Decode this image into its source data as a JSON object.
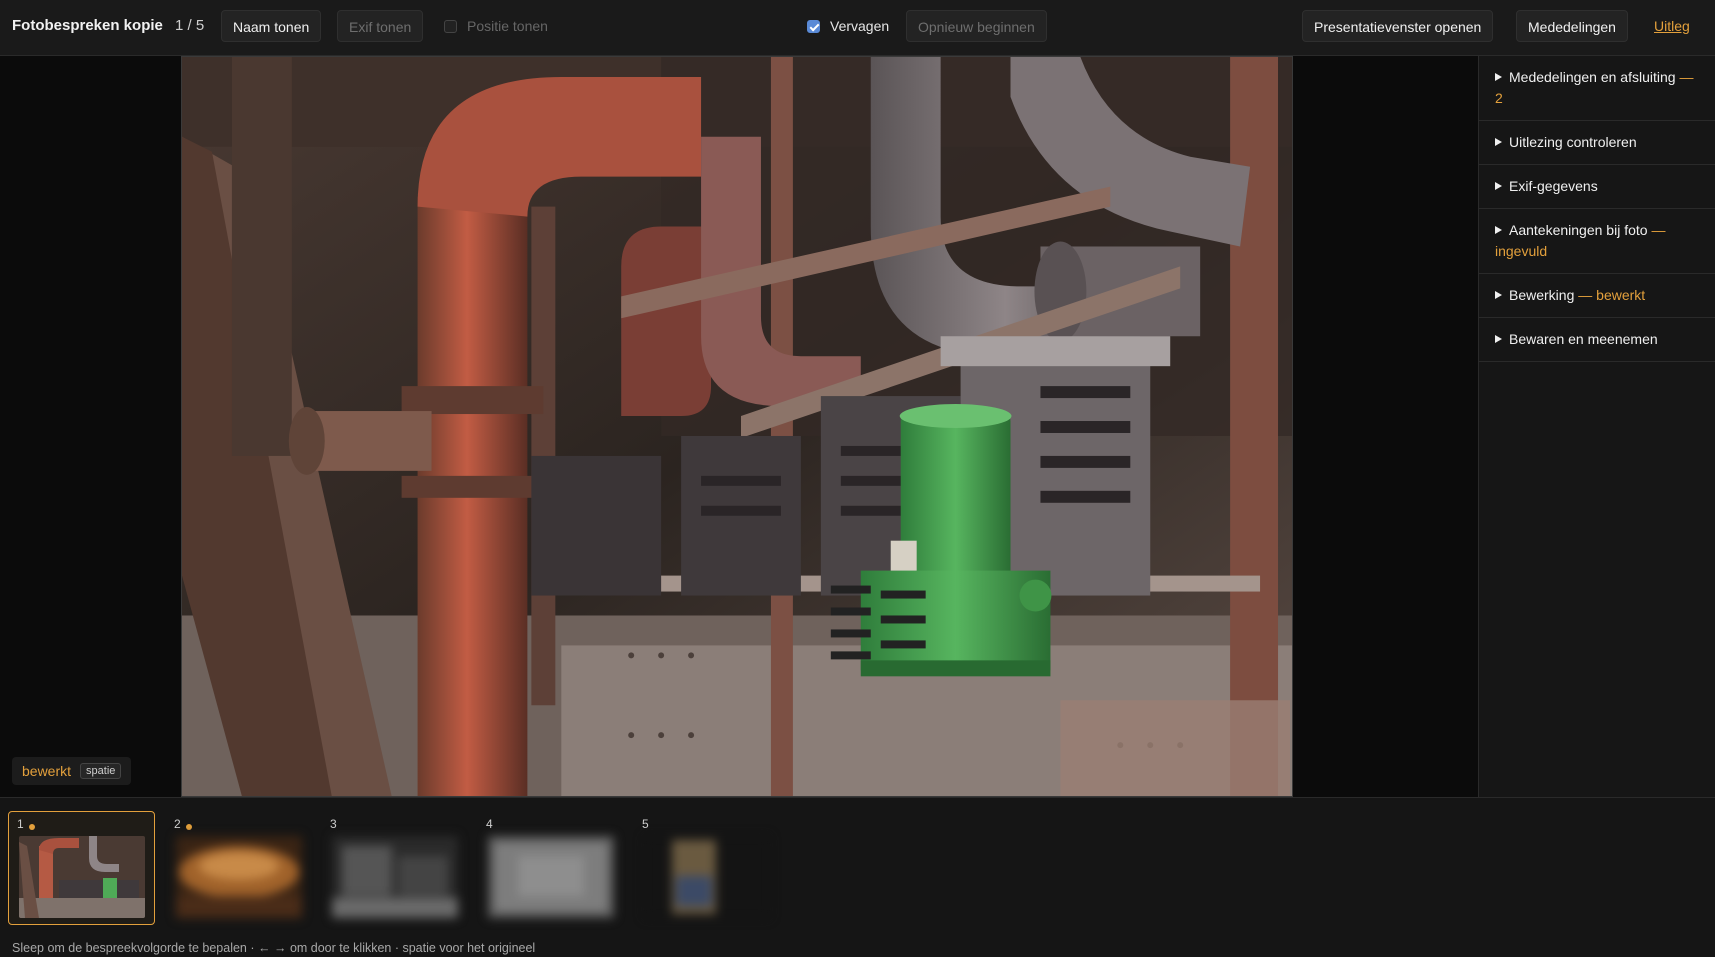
{
  "toolbar": {
    "app_title": "Fotobespreken kopie",
    "counter": "1 / 5",
    "show_name_label": "Naam tonen",
    "show_exif_label": "Exif tonen",
    "show_position_label": "Positie tonen",
    "show_position_checked": false,
    "fade_label": "Vervagen",
    "fade_checked": true,
    "restart_label": "Opnieuw beginnen",
    "open_presentation_label": "Presentatievenster openen",
    "notices_label": "Mededelingen",
    "help_label": "Uitleg"
  },
  "stage": {
    "edited_label": "bewerkt",
    "key_hint": "spatie"
  },
  "side_panel": {
    "sections": [
      {
        "title": "Mededelingen en afsluiting",
        "extra": "— 2"
      },
      {
        "title": "Uitlezing controleren",
        "extra": ""
      },
      {
        "title": "Exif-gegevens",
        "extra": ""
      },
      {
        "title": "Aantekeningen bij foto",
        "extra": "— ingevuld"
      },
      {
        "title": "Bewerking",
        "extra": "— bewerkt"
      },
      {
        "title": "Bewaren en meenemen",
        "extra": ""
      }
    ]
  },
  "filmstrip": {
    "thumbs": [
      {
        "number": "1",
        "marked": true,
        "active": true
      },
      {
        "number": "2",
        "marked": true,
        "active": false
      },
      {
        "number": "3",
        "marked": false,
        "active": false
      },
      {
        "number": "4",
        "marked": false,
        "active": false
      },
      {
        "number": "5",
        "marked": false,
        "active": false
      }
    ],
    "hint": "Sleep om de bespreekvolgorde te bepalen · ← → om door te klikken · spatie voor het origineel"
  },
  "colors": {
    "accent": "#e3a03c",
    "checkbox": "#5a8ad6",
    "background": "#0e0e0e",
    "panel": "#161616"
  }
}
